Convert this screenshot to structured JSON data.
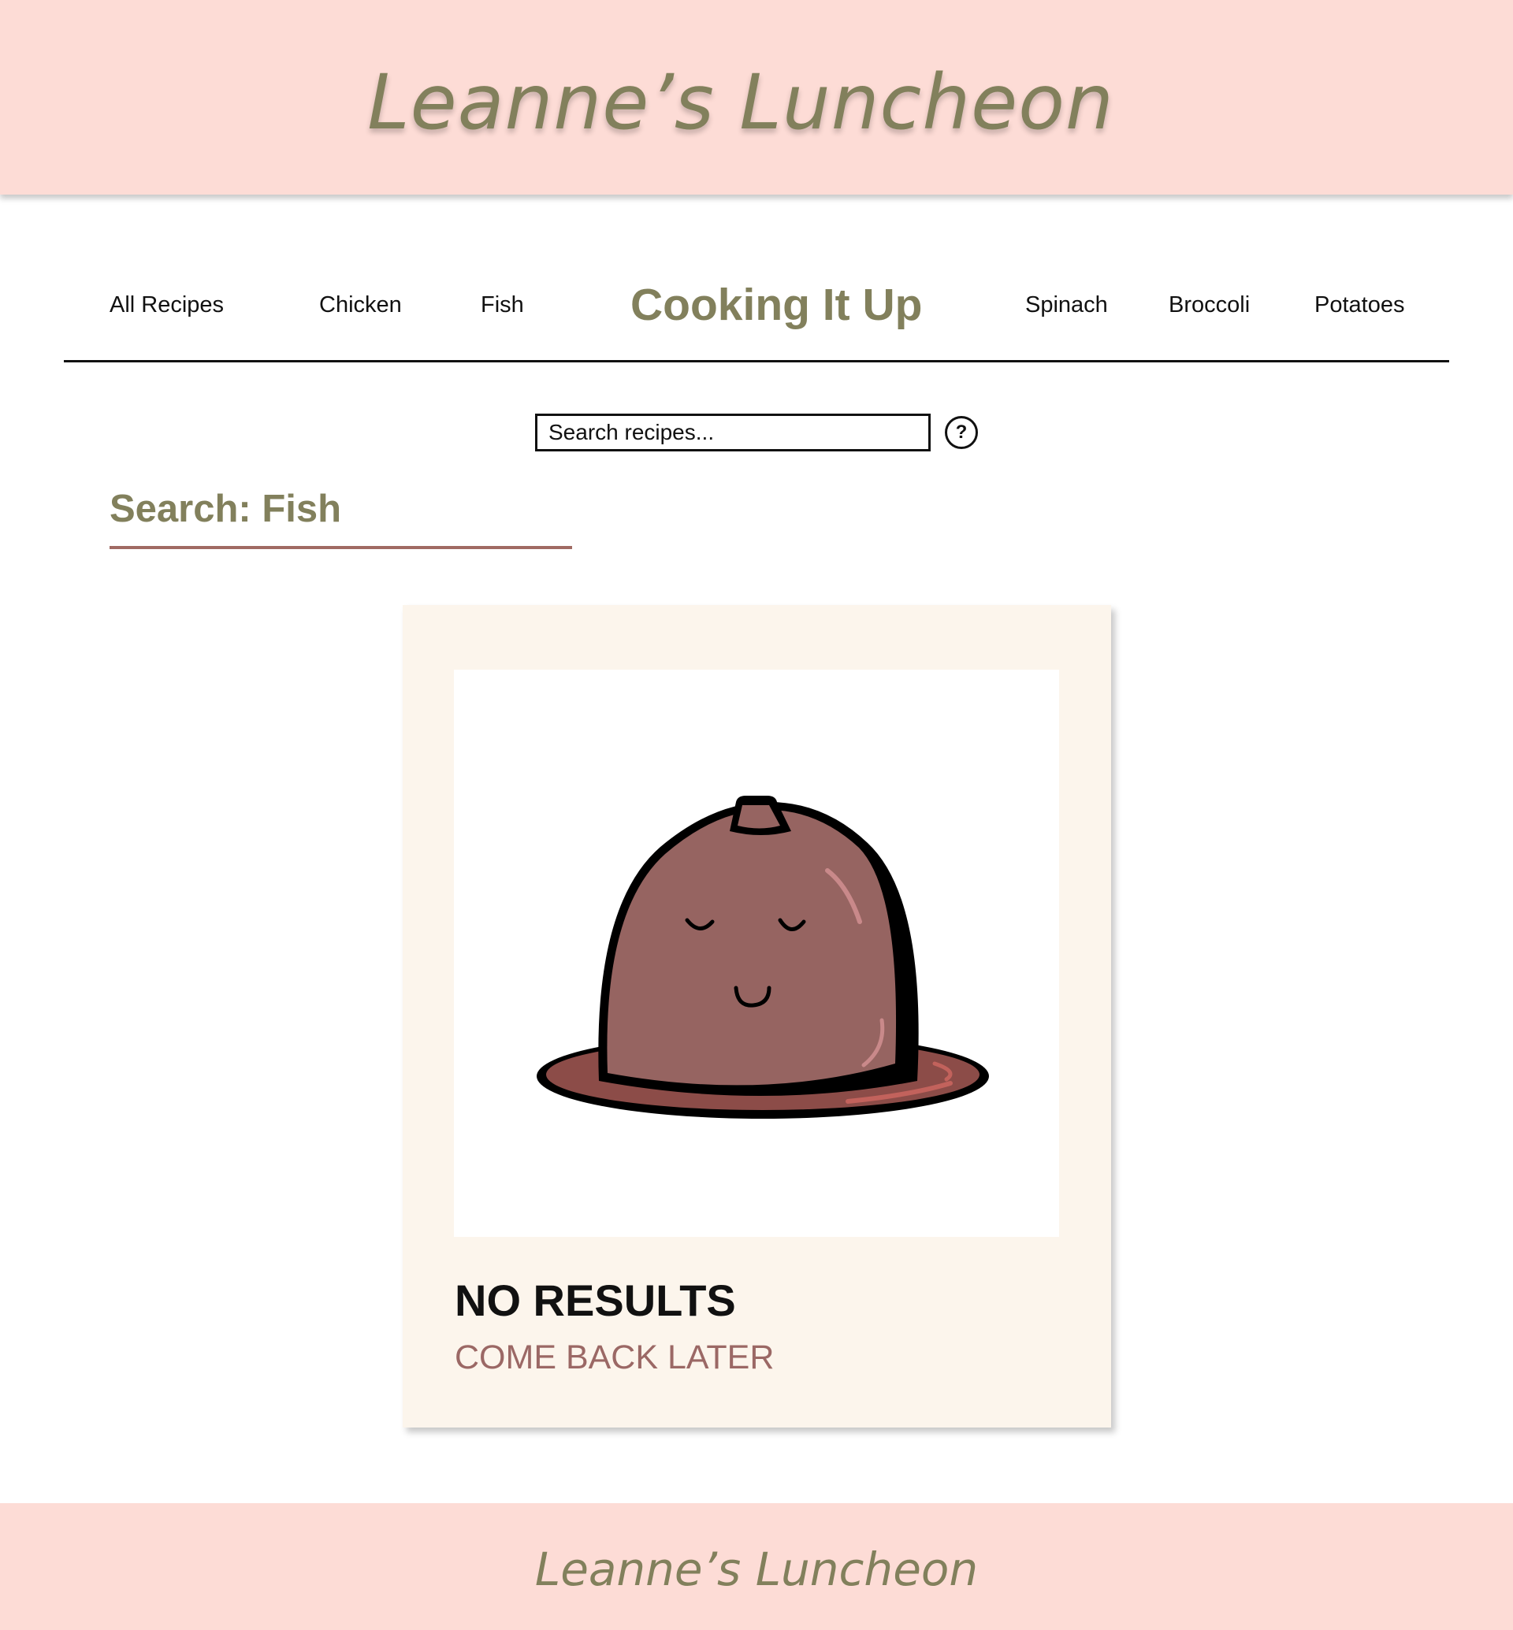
{
  "header": {
    "site_title": "Leanne’s Luncheon"
  },
  "nav": {
    "left_items": [
      "All Recipes",
      "Chicken",
      "Fish"
    ],
    "brand": "Cooking It Up",
    "right_items": [
      "Spinach",
      "Broccoli",
      "Potatoes"
    ]
  },
  "search": {
    "placeholder": "Search recipes...",
    "help_icon_glyph": "?",
    "help_icon": "question-circle-icon"
  },
  "results": {
    "heading": "Search: Fish",
    "card": {
      "image": "cloche-face-illustration",
      "title": "NO RESULTS",
      "subtitle": "COME BACK LATER"
    }
  },
  "footer": {
    "site_title": "Leanne’s Luncheon"
  },
  "colors": {
    "header_bg": "#fddcd6",
    "brand_olive": "#82805c",
    "card_bg": "#fcf5ec",
    "accent_rose": "#9b6865",
    "cloche_dome": "#966461",
    "cloche_plate": "#8c4c48"
  }
}
